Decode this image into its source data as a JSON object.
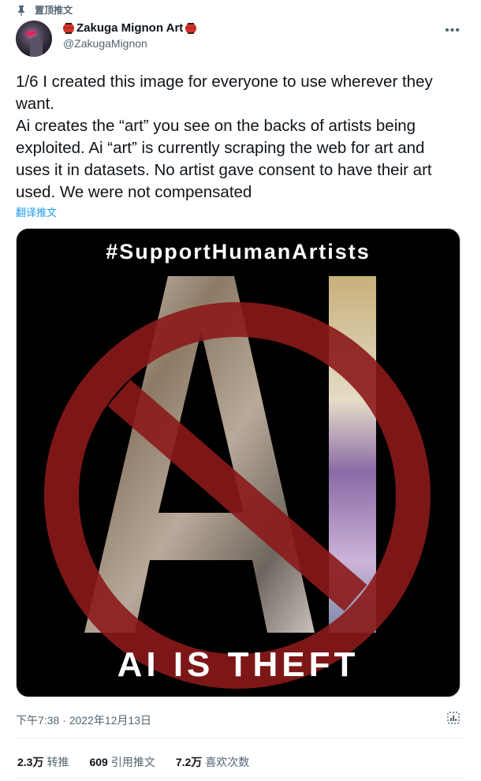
{
  "pinned": {
    "label": "置顶推文",
    "icon": "pin-icon"
  },
  "author": {
    "display_name": "Zakuga Mignon Art",
    "handle": "@ZakugaMignon",
    "avatar_icon": "avatar",
    "badge_icon": "red-lantern-icon"
  },
  "more_icon": "more-options-icon",
  "tweet": {
    "line1": "1/6 I created this image for everyone to use wherever they want.",
    "line2": "Ai creates the “art” you see on the backs of artists being exploited. Ai “art” is currently scraping the web for art and uses it in datasets. No artist gave consent to have their art used. We were not compensated",
    "translate": "翻译推文"
  },
  "media": {
    "hashtag": "#SupportHumanArtists",
    "big_letters": "AI",
    "caption": "AI IS THEFT",
    "colors": {
      "background": "#000000",
      "prohibition": "#8b1a1a"
    }
  },
  "timestamp": "下午7:38 · 2022年12月13日",
  "stats": [
    {
      "count": "2.3万",
      "label": "转推"
    },
    {
      "count": "609",
      "label": "引用推文"
    },
    {
      "count": "7.2万",
      "label": "喜欢次数"
    }
  ],
  "colors": {
    "secondary_text": "#536471",
    "link": "#1d9bf0",
    "primary_text": "#0f1419"
  }
}
